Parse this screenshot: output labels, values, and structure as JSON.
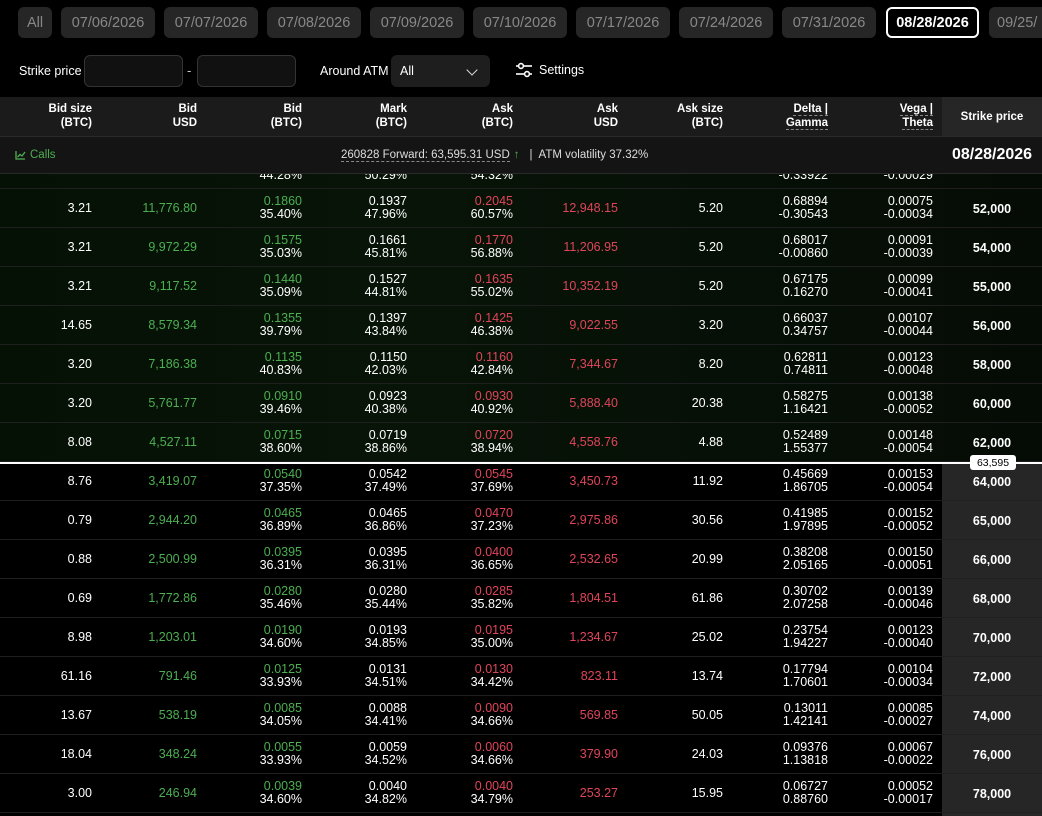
{
  "tabs": [
    "All",
    "07/06/2026",
    "07/07/2026",
    "07/08/2026",
    "07/09/2026",
    "07/10/2026",
    "07/17/2026",
    "07/24/2026",
    "07/31/2026",
    "08/28/2026",
    "09/25/"
  ],
  "active_tab": "08/28/2026",
  "filters": {
    "strike_label": "Strike price",
    "dash": "-",
    "strike_min_placeholder": "",
    "strike_max_placeholder": "",
    "atm_label": "Around ATM",
    "atm_value": "All",
    "settings_label": "Settings"
  },
  "headers": [
    {
      "l1": "Bid size",
      "l2": "(BTC)"
    },
    {
      "l1": "Bid",
      "l2": "USD"
    },
    {
      "l1": "Bid",
      "l2": "(BTC)"
    },
    {
      "l1": "Mark",
      "l2": "(BTC)"
    },
    {
      "l1": "Ask",
      "l2": "(BTC)"
    },
    {
      "l1": "Ask",
      "l2": "USD"
    },
    {
      "l1": "Ask size",
      "l2": "(BTC)"
    },
    {
      "l1": "Delta |",
      "l2": "Gamma"
    },
    {
      "l1": "Vega |",
      "l2": "Theta"
    }
  ],
  "strike_header": "Strike price",
  "info": {
    "calls_label": "Calls",
    "forward_label": "260828 Forward: 63,595.31 USD",
    "forward_arrow": "↑",
    "separator": "|",
    "atm_vol": "ATM volatility 37.32%",
    "expiry": "08/28/2026"
  },
  "partial_row": {
    "bid_iv": "44.28%",
    "mark_iv": "50.29%",
    "ask_iv": "54.32%",
    "gamma": "-0.33922",
    "theta": "-0.00029"
  },
  "atm_price": "63,595",
  "rows": [
    {
      "bid_size": "3.21",
      "bid_usd": "11,776.80",
      "bid_btc": "0.1860",
      "bid_iv": "35.40%",
      "mark": "0.1937",
      "mark_iv": "47.96%",
      "ask_btc": "0.2045",
      "ask_iv": "60.57%",
      "ask_usd": "12,948.15",
      "ask_size": "5.20",
      "delta": "0.68894",
      "gamma": "-0.30543",
      "vega": "0.00075",
      "theta": "-0.00034",
      "strike": "52,000",
      "itm": true
    },
    {
      "bid_size": "3.21",
      "bid_usd": "9,972.29",
      "bid_btc": "0.1575",
      "bid_iv": "35.03%",
      "mark": "0.1661",
      "mark_iv": "45.81%",
      "ask_btc": "0.1770",
      "ask_iv": "56.88%",
      "ask_usd": "11,206.95",
      "ask_size": "5.20",
      "delta": "0.68017",
      "gamma": "-0.00860",
      "vega": "0.00091",
      "theta": "-0.00039",
      "strike": "54,000",
      "itm": true
    },
    {
      "bid_size": "3.21",
      "bid_usd": "9,117.52",
      "bid_btc": "0.1440",
      "bid_iv": "35.09%",
      "mark": "0.1527",
      "mark_iv": "44.81%",
      "ask_btc": "0.1635",
      "ask_iv": "55.02%",
      "ask_usd": "10,352.19",
      "ask_size": "5.20",
      "delta": "0.67175",
      "gamma": "0.16270",
      "vega": "0.00099",
      "theta": "-0.00041",
      "strike": "55,000",
      "itm": true
    },
    {
      "bid_size": "14.65",
      "bid_usd": "8,579.34",
      "bid_btc": "0.1355",
      "bid_iv": "39.79%",
      "mark": "0.1397",
      "mark_iv": "43.84%",
      "ask_btc": "0.1425",
      "ask_iv": "46.38%",
      "ask_usd": "9,022.55",
      "ask_size": "3.20",
      "delta": "0.66037",
      "gamma": "0.34757",
      "vega": "0.00107",
      "theta": "-0.00044",
      "strike": "56,000",
      "itm": true
    },
    {
      "bid_size": "3.20",
      "bid_usd": "7,186.38",
      "bid_btc": "0.1135",
      "bid_iv": "40.83%",
      "mark": "0.1150",
      "mark_iv": "42.03%",
      "ask_btc": "0.1160",
      "ask_iv": "42.84%",
      "ask_usd": "7,344.67",
      "ask_size": "8.20",
      "delta": "0.62811",
      "gamma": "0.74811",
      "vega": "0.00123",
      "theta": "-0.00048",
      "strike": "58,000",
      "itm": true
    },
    {
      "bid_size": "3.20",
      "bid_usd": "5,761.77",
      "bid_btc": "0.0910",
      "bid_iv": "39.46%",
      "mark": "0.0923",
      "mark_iv": "40.38%",
      "ask_btc": "0.0930",
      "ask_iv": "40.92%",
      "ask_usd": "5,888.40",
      "ask_size": "20.38",
      "delta": "0.58275",
      "gamma": "1.16421",
      "vega": "0.00138",
      "theta": "-0.00052",
      "strike": "60,000",
      "itm": true
    },
    {
      "bid_size": "8.08",
      "bid_usd": "4,527.11",
      "bid_btc": "0.0715",
      "bid_iv": "38.60%",
      "mark": "0.0719",
      "mark_iv": "38.86%",
      "ask_btc": "0.0720",
      "ask_iv": "38.94%",
      "ask_usd": "4,558.76",
      "ask_size": "4.88",
      "delta": "0.52489",
      "gamma": "1.55377",
      "vega": "0.00148",
      "theta": "-0.00054",
      "strike": "62,000",
      "itm": true
    },
    {
      "bid_size": "8.76",
      "bid_usd": "3,419.07",
      "bid_btc": "0.0540",
      "bid_iv": "37.35%",
      "mark": "0.0542",
      "mark_iv": "37.49%",
      "ask_btc": "0.0545",
      "ask_iv": "37.69%",
      "ask_usd": "3,450.73",
      "ask_size": "11.92",
      "delta": "0.45669",
      "gamma": "1.86705",
      "vega": "0.00153",
      "theta": "-0.00054",
      "strike": "64,000",
      "itm": false
    },
    {
      "bid_size": "0.79",
      "bid_usd": "2,944.20",
      "bid_btc": "0.0465",
      "bid_iv": "36.89%",
      "mark": "0.0465",
      "mark_iv": "36.86%",
      "ask_btc": "0.0470",
      "ask_iv": "37.23%",
      "ask_usd": "2,975.86",
      "ask_size": "30.56",
      "delta": "0.41985",
      "gamma": "1.97895",
      "vega": "0.00152",
      "theta": "-0.00052",
      "strike": "65,000",
      "itm": false
    },
    {
      "bid_size": "0.88",
      "bid_usd": "2,500.99",
      "bid_btc": "0.0395",
      "bid_iv": "36.31%",
      "mark": "0.0395",
      "mark_iv": "36.31%",
      "ask_btc": "0.0400",
      "ask_iv": "36.65%",
      "ask_usd": "2,532.65",
      "ask_size": "20.99",
      "delta": "0.38208",
      "gamma": "2.05165",
      "vega": "0.00150",
      "theta": "-0.00051",
      "strike": "66,000",
      "itm": false
    },
    {
      "bid_size": "0.69",
      "bid_usd": "1,772.86",
      "bid_btc": "0.0280",
      "bid_iv": "35.46%",
      "mark": "0.0280",
      "mark_iv": "35.44%",
      "ask_btc": "0.0285",
      "ask_iv": "35.82%",
      "ask_usd": "1,804.51",
      "ask_size": "61.86",
      "delta": "0.30702",
      "gamma": "2.07258",
      "vega": "0.00139",
      "theta": "-0.00046",
      "strike": "68,000",
      "itm": false
    },
    {
      "bid_size": "8.98",
      "bid_usd": "1,203.01",
      "bid_btc": "0.0190",
      "bid_iv": "34.60%",
      "mark": "0.0193",
      "mark_iv": "34.85%",
      "ask_btc": "0.0195",
      "ask_iv": "35.00%",
      "ask_usd": "1,234.67",
      "ask_size": "25.02",
      "delta": "0.23754",
      "gamma": "1.94227",
      "vega": "0.00123",
      "theta": "-0.00040",
      "strike": "70,000",
      "itm": false
    },
    {
      "bid_size": "61.16",
      "bid_usd": "791.46",
      "bid_btc": "0.0125",
      "bid_iv": "33.93%",
      "mark": "0.0131",
      "mark_iv": "34.51%",
      "ask_btc": "0.0130",
      "ask_iv": "34.42%",
      "ask_usd": "823.11",
      "ask_size": "13.74",
      "delta": "0.17794",
      "gamma": "1.70601",
      "vega": "0.00104",
      "theta": "-0.00034",
      "strike": "72,000",
      "itm": false
    },
    {
      "bid_size": "13.67",
      "bid_usd": "538.19",
      "bid_btc": "0.0085",
      "bid_iv": "34.05%",
      "mark": "0.0088",
      "mark_iv": "34.41%",
      "ask_btc": "0.0090",
      "ask_iv": "34.66%",
      "ask_usd": "569.85",
      "ask_size": "50.05",
      "delta": "0.13011",
      "gamma": "1.42141",
      "vega": "0.00085",
      "theta": "-0.00027",
      "strike": "74,000",
      "itm": false
    },
    {
      "bid_size": "18.04",
      "bid_usd": "348.24",
      "bid_btc": "0.0055",
      "bid_iv": "33.93%",
      "mark": "0.0059",
      "mark_iv": "34.52%",
      "ask_btc": "0.0060",
      "ask_iv": "34.66%",
      "ask_usd": "379.90",
      "ask_size": "24.03",
      "delta": "0.09376",
      "gamma": "1.13818",
      "vega": "0.00067",
      "theta": "-0.00022",
      "strike": "76,000",
      "itm": false
    },
    {
      "bid_size": "3.00",
      "bid_usd": "246.94",
      "bid_btc": "0.0039",
      "bid_iv": "34.60%",
      "mark": "0.0040",
      "mark_iv": "34.82%",
      "ask_btc": "0.0040",
      "ask_iv": "34.79%",
      "ask_usd": "253.27",
      "ask_size": "15.95",
      "delta": "0.06727",
      "gamma": "0.88760",
      "vega": "0.00052",
      "theta": "-0.00017",
      "strike": "78,000",
      "itm": false
    }
  ],
  "colors": {
    "green": "#4caf50",
    "red": "#e0455a",
    "strike_bg": "#262626",
    "header_bg": "#1b1b1b"
  }
}
